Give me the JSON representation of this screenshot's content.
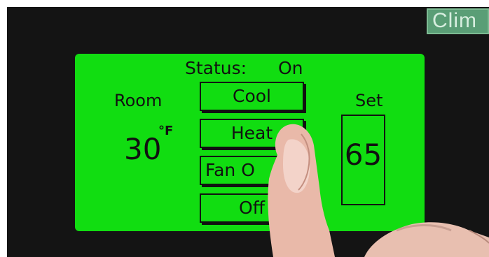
{
  "brand": {
    "text": "Clim"
  },
  "status": {
    "label": "Status:",
    "value": "On"
  },
  "room": {
    "label": "Room",
    "temperature": "30",
    "unit": "°F"
  },
  "set": {
    "label": "Set",
    "value": "65"
  },
  "modes": [
    {
      "label": "Cool"
    },
    {
      "label": "Heat"
    },
    {
      "label": "Fan O"
    },
    {
      "label": "Off"
    }
  ],
  "colors": {
    "screen": "#11dd11",
    "bezel": "#141414",
    "brand": "#5a9e76",
    "text": "#111111"
  }
}
